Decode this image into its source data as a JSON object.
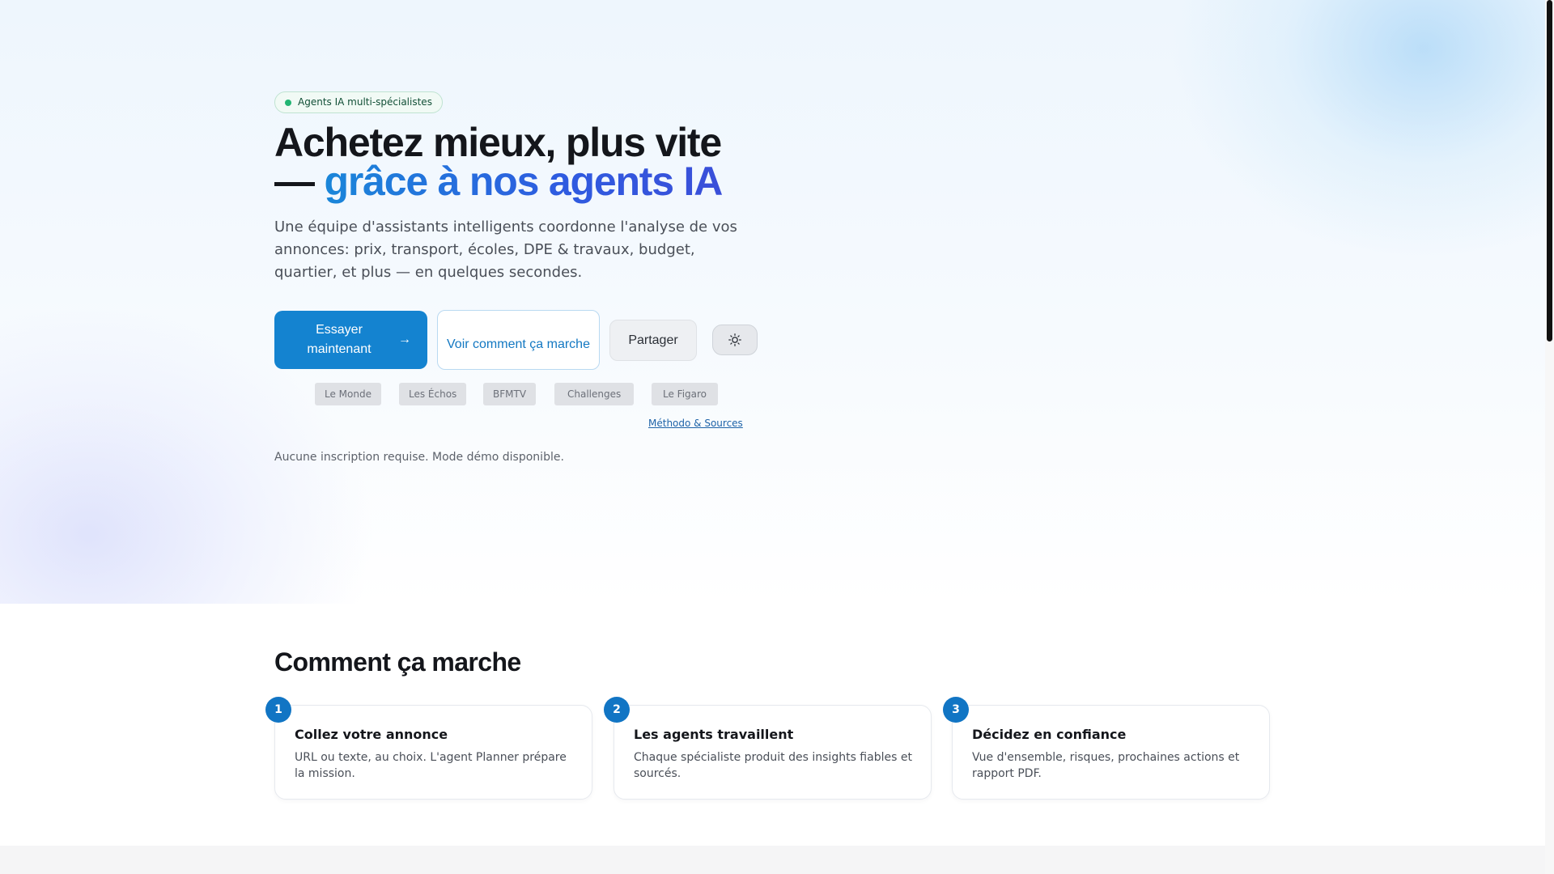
{
  "hero": {
    "badge": "Agents IA multi-spécialistes",
    "headline_line1": "Achetez mieux, plus vite",
    "headline_dash": "— ",
    "headline_accent": "grâce à nos agents IA",
    "subtitle": "Une équipe d'assistants intelligents coordonne l'analyse de vos annonces: prix, transport, écoles, DPE & travaux, budget, quartier, et plus — en quelques secondes.",
    "primary_button": "Essayer maintenant",
    "primary_button_arrow": "→",
    "secondary_button": "Voir comment ça marche",
    "share_button": "Partager",
    "theme_toggle_icon": "sun-icon",
    "press": [
      "Le Monde",
      "Les Échos",
      "BFMTV",
      "Challenges",
      "Le Figaro"
    ],
    "method_link": "Méthodo & Sources",
    "note": "Aucune inscription requise. Mode démo disponible."
  },
  "how_it_works": {
    "title": "Comment ça marche",
    "steps": [
      {
        "number": "1",
        "title": "Collez votre annonce",
        "description": "URL ou texte, au choix. L'agent Planner prépare la mission."
      },
      {
        "number": "2",
        "title": "Les agents travaillent",
        "description": "Chaque spécialiste produit des insights fiables et sourcés."
      },
      {
        "number": "3",
        "title": "Décidez en confiance",
        "description": "Vue d'ensemble, risques, prochaines actions et rapport PDF."
      }
    ]
  },
  "colors": {
    "primary": "#1483d0",
    "accent_gradient_start": "#1a86d9",
    "accent_gradient_end": "#3a4fd9",
    "badge_dot": "#22b573",
    "step_badge": "#1175c4"
  }
}
